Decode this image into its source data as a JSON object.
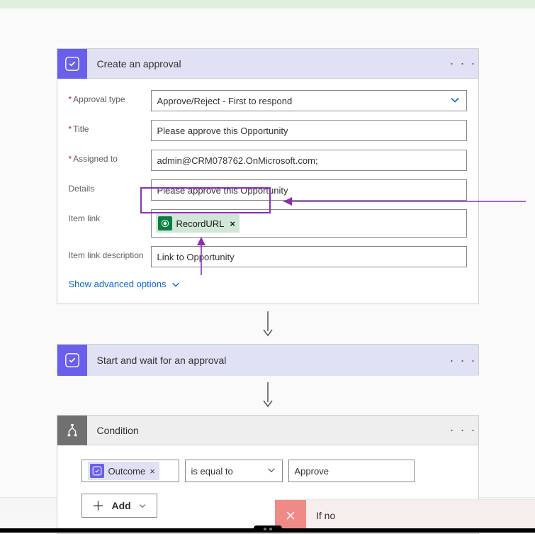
{
  "approval_card": {
    "title": "Create an approval",
    "rows": {
      "approval_type": {
        "label": "Approval type",
        "required": true,
        "value": "Approve/Reject - First to respond"
      },
      "title_field": {
        "label": "Title",
        "required": true,
        "value": "Please approve this Opportunity"
      },
      "assigned_to": {
        "label": "Assigned to",
        "required": true,
        "value": "admin@CRM078762.OnMicrosoft.com;"
      },
      "details": {
        "label": "Details",
        "required": false,
        "value": "Please approve this Opportunity"
      },
      "item_link": {
        "label": "Item link",
        "required": false,
        "token": "RecordURL"
      },
      "item_link_desc": {
        "label": "Item link description",
        "required": false,
        "value": "Link to Opportunity"
      }
    },
    "advanced_label": "Show advanced options"
  },
  "start_wait": {
    "title": "Start and wait for an approval"
  },
  "condition": {
    "title": "Condition",
    "outcome_token": "Outcome",
    "operator": "is equal to",
    "value": "Approve",
    "add_label": "Add"
  },
  "ifno": {
    "label": "If no"
  }
}
